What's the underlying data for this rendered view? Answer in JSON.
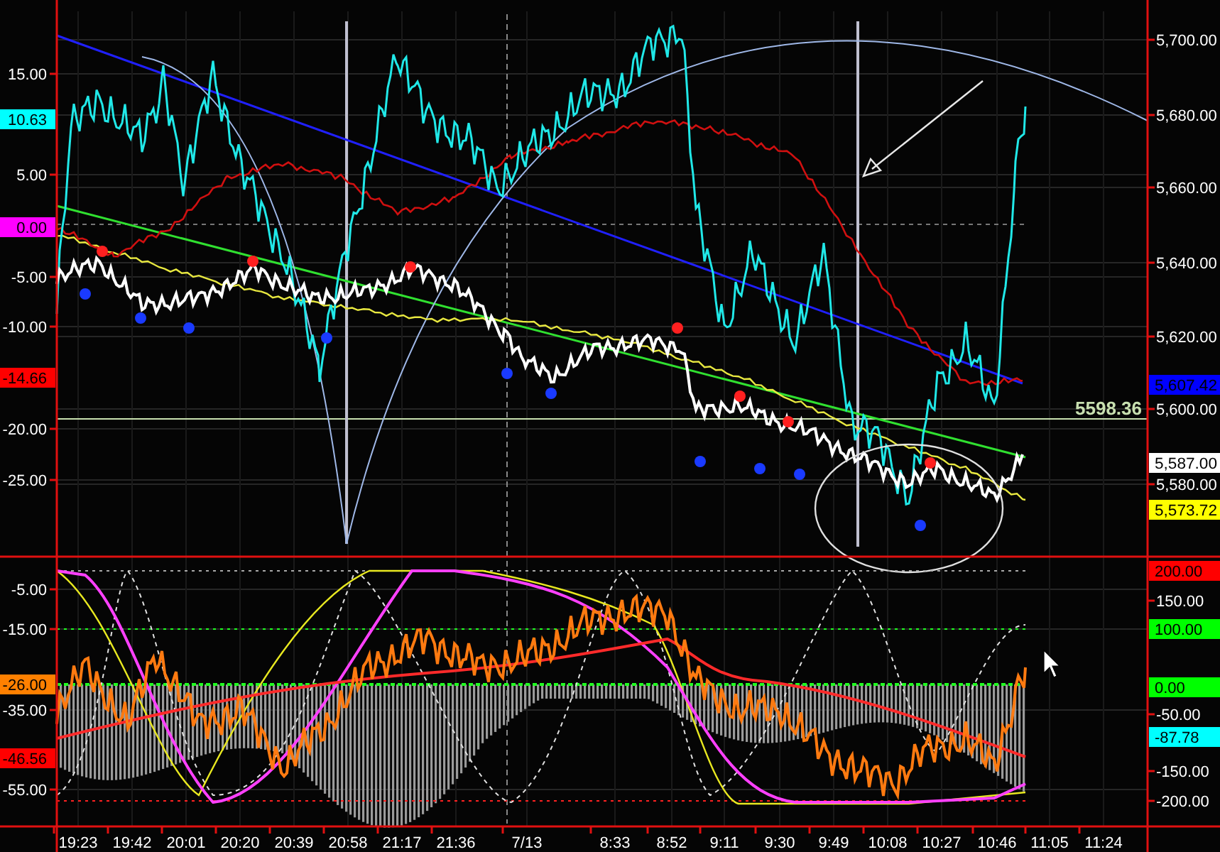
{
  "left_axis": {
    "upper_ticks": [
      "15.00",
      "5.00",
      "-5.00",
      "-10.00",
      "-20.00",
      "-25.00"
    ],
    "upper_flags": [
      {
        "label": "10.63",
        "color": "#00ffff"
      },
      {
        "label": "0.00",
        "color": "#ff00ff"
      },
      {
        "label": "-14.66",
        "color": "#ff0000"
      }
    ],
    "lower_ticks": [
      "-5.00",
      "-15.00",
      "-35.00",
      "-55.00"
    ],
    "lower_flags": [
      {
        "label": "-26.00",
        "color": "#ff8000"
      },
      {
        "label": "-46.56",
        "color": "#ff0000"
      }
    ]
  },
  "right_axis": {
    "upper_ticks": [
      "5,700.00",
      "5,680.00",
      "5,660.00",
      "5,640.00",
      "5,620.00",
      "5,600.00",
      "5,580.00"
    ],
    "upper_flags": [
      {
        "label": "5,607.42",
        "color": "#0000ff"
      },
      {
        "label": "5,587.00",
        "color": "#ffffff"
      },
      {
        "label": "5,573.72",
        "color": "#ffff00"
      }
    ],
    "lower_ticks": [
      "150.00",
      "-50.00",
      "-150.00",
      "-200.00"
    ],
    "lower_flags": [
      {
        "label": "200.00",
        "color": "#ff0000"
      },
      {
        "label": "100.00",
        "color": "#00ff00"
      },
      {
        "label": "0.00",
        "color": "#00ff00"
      },
      {
        "label": "-87.78",
        "color": "#00ffff"
      }
    ]
  },
  "price_label": "5598.36",
  "time_axis": [
    "19:23",
    "19:42",
    "20:01",
    "20:20",
    "20:39",
    "20:58",
    "21:17",
    "21:36",
    "7/13",
    "8:33",
    "8:52",
    "9:11",
    "9:30",
    "9:49",
    "10:08",
    "10:27",
    "10:46",
    "11:05",
    "11:24"
  ]
}
